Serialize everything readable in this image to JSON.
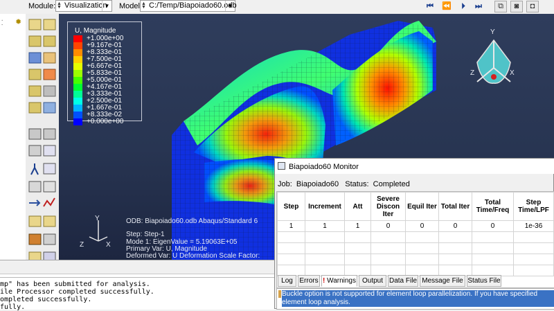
{
  "toolbar": {
    "module_label": "Module:",
    "module_value": "Visualization",
    "model_label": "Model:",
    "model_value": "C:/Temp/Biapoiado60.odb"
  },
  "legend": {
    "title": "U, Magnitude",
    "entries": [
      {
        "value": "+1.000e+00",
        "color": "#ff0000"
      },
      {
        "value": "+9.167e-01",
        "color": "#ff4500"
      },
      {
        "value": "+8.333e-01",
        "color": "#ff8c00"
      },
      {
        "value": "+7.500e-01",
        "color": "#ffd000"
      },
      {
        "value": "+6.667e-01",
        "color": "#e6ff00"
      },
      {
        "value": "+5.833e-01",
        "color": "#9cff00"
      },
      {
        "value": "+5.000e-01",
        "color": "#46ff00"
      },
      {
        "value": "+4.167e-01",
        "color": "#00ff32"
      },
      {
        "value": "+3.333e-01",
        "color": "#00ff96"
      },
      {
        "value": "+2.500e-01",
        "color": "#00ffe6"
      },
      {
        "value": "+1.667e-01",
        "color": "#00b4ff"
      },
      {
        "value": "+8.333e-02",
        "color": "#0050ff"
      },
      {
        "value": "+0.000e+00",
        "color": "#0000ff"
      }
    ]
  },
  "viewport_info": {
    "odb_line": "ODB: Biapoiado60.odb    Abaqus/Standard 6",
    "step_line": "Step: Step-1",
    "mode_line": "Mode       1: EigenValue =  5.19063E+05",
    "primary_line": "Primary Var: U, Magnitude",
    "deformed_line": "Deformed Var: U   Deformation Scale Factor:"
  },
  "triad": {
    "x": "X",
    "y": "Y",
    "z": "Z"
  },
  "messages": [
    "mp\" has been submitted for analysis.",
    "ile Processor completed successfully.",
    "ompleted successfully.",
    "fully."
  ],
  "monitor": {
    "title": "Biapoiado60 Monitor",
    "job_label": "Job:",
    "job_name": "Biapoiado60",
    "status_label": "Status:",
    "status_value": "Completed",
    "columns": [
      "Step",
      "Increment",
      "Att",
      "Severe Discon Iter",
      "Equil Iter",
      "Total Iter",
      "Total Time/Freq",
      "Step Time/LPF"
    ],
    "row": [
      "1",
      "1",
      "1",
      "0",
      "0",
      "0",
      "0",
      "1e-36"
    ],
    "tabs": [
      "Log",
      "Errors",
      "! Warnings",
      "Output",
      "Data File",
      "Message File",
      "Status File"
    ],
    "warning_text": "Buckle option is not supported for element loop parallelization. If you have specified element loop analysis."
  },
  "colors": {
    "viewport_top": "#2f3d5c",
    "selection": "#3a72c4",
    "tab_warning_mark": "#d00000"
  }
}
